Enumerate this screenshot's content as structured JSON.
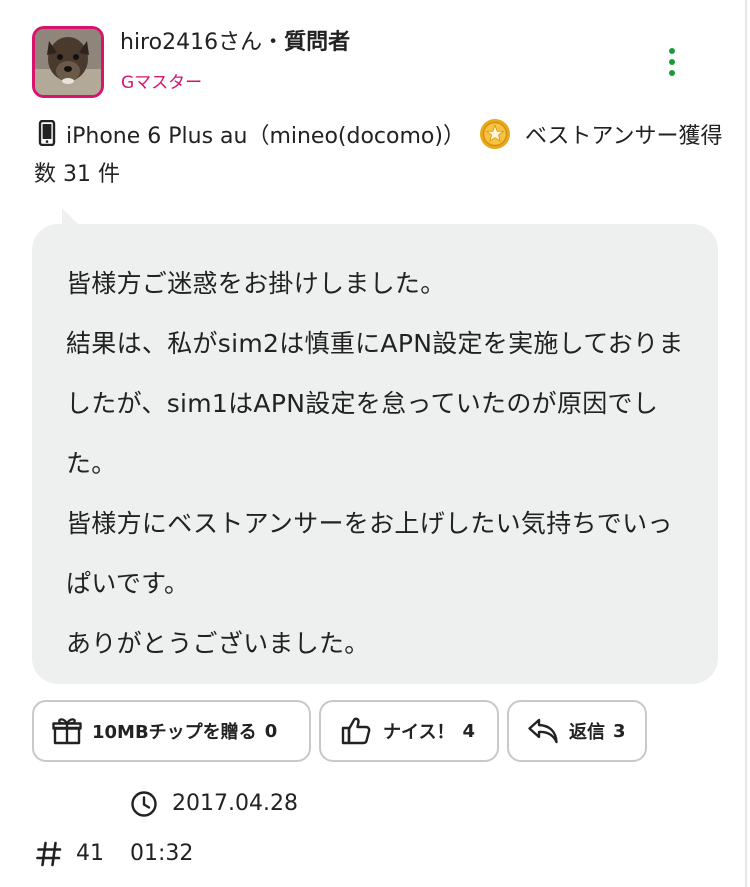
{
  "author": {
    "name": "hiro2416さん",
    "separator": "・",
    "role": "質問者",
    "rank": "Gマスター"
  },
  "device": {
    "model": "iPhone 6 Plus au（mineo(docomo)）",
    "best_answer_text": "ベストアンサー獲得数 31 件"
  },
  "message": {
    "paragraphs": [
      "皆様方ご迷惑をお掛けしました。",
      "結果は、私がsim2は慎重にAPN設定を実施しておりましたが、sim1はAPN設定を怠っていたのが原因でした。",
      "皆様方にベストアンサーをお上げしたい気持ちでいっぱいです。",
      "ありがとうございました。"
    ]
  },
  "actions": {
    "tip": {
      "label": "10MBチップを贈る",
      "count": "0"
    },
    "nice": {
      "label": "ナイス！",
      "count": "4"
    },
    "reply": {
      "label": "返信",
      "count": "3"
    }
  },
  "footer": {
    "date": "2017.04.28",
    "post_number": "41",
    "time": "01:32"
  },
  "colors": {
    "accent_pink": "#d6146e",
    "menu_green": "#1a9b3a",
    "bubble_bg": "#edf0ee"
  },
  "icons": {
    "avatar": "dog-photo-avatar",
    "more": "vertical-dots-icon",
    "device": "smartphone-icon",
    "best_answer": "gold-medal-icon",
    "tip": "gift-icon",
    "nice": "thumbs-up-icon",
    "reply": "reply-arrow-icon",
    "date": "clock-icon",
    "post_number": "hash-icon"
  }
}
